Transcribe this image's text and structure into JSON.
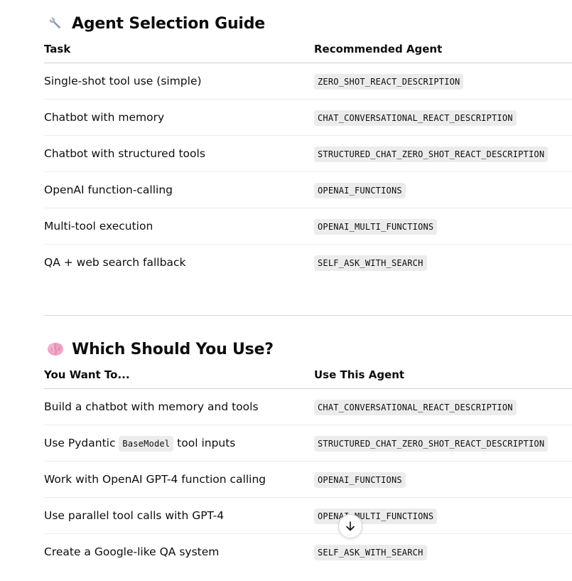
{
  "section1": {
    "icon": "wrench-icon",
    "title": "Agent Selection Guide",
    "headers": [
      "Task",
      "Recommended Agent"
    ],
    "rows": [
      {
        "task": "Single-shot tool use (simple)",
        "agent": "ZERO_SHOT_REACT_DESCRIPTION"
      },
      {
        "task": "Chatbot with memory",
        "agent": "CHAT_CONVERSATIONAL_REACT_DESCRIPTION"
      },
      {
        "task": "Chatbot with structured tools",
        "agent": "STRUCTURED_CHAT_ZERO_SHOT_REACT_DESCRIPTION"
      },
      {
        "task": "OpenAI function-calling",
        "agent": "OPENAI_FUNCTIONS"
      },
      {
        "task": "Multi-tool execution",
        "agent": "OPENAI_MULTI_FUNCTIONS"
      },
      {
        "task": "QA + web search fallback",
        "agent": "SELF_ASK_WITH_SEARCH"
      }
    ]
  },
  "section2": {
    "icon": "brain-icon",
    "title": "Which Should You Use?",
    "headers": [
      "You Want To...",
      "Use This Agent"
    ],
    "rows": [
      {
        "want": "Build a chatbot with memory and tools",
        "agent": "CHAT_CONVERSATIONAL_REACT_DESCRIPTION"
      },
      {
        "want_prefix": "Use Pydantic ",
        "want_code": "BaseModel",
        "want_suffix": " tool inputs",
        "agent": "STRUCTURED_CHAT_ZERO_SHOT_REACT_DESCRIPTION"
      },
      {
        "want": "Work with OpenAI GPT-4 function calling",
        "agent": "OPENAI_FUNCTIONS"
      },
      {
        "want": "Use parallel tool calls with GPT-4",
        "agent": "OPENAI_MULTI_FUNCTIONS"
      },
      {
        "want": "Create a Google-like QA system",
        "agent": "SELF_ASK_WITH_SEARCH"
      }
    ]
  },
  "scroll_button": {
    "icon": "arrow-down-icon"
  }
}
